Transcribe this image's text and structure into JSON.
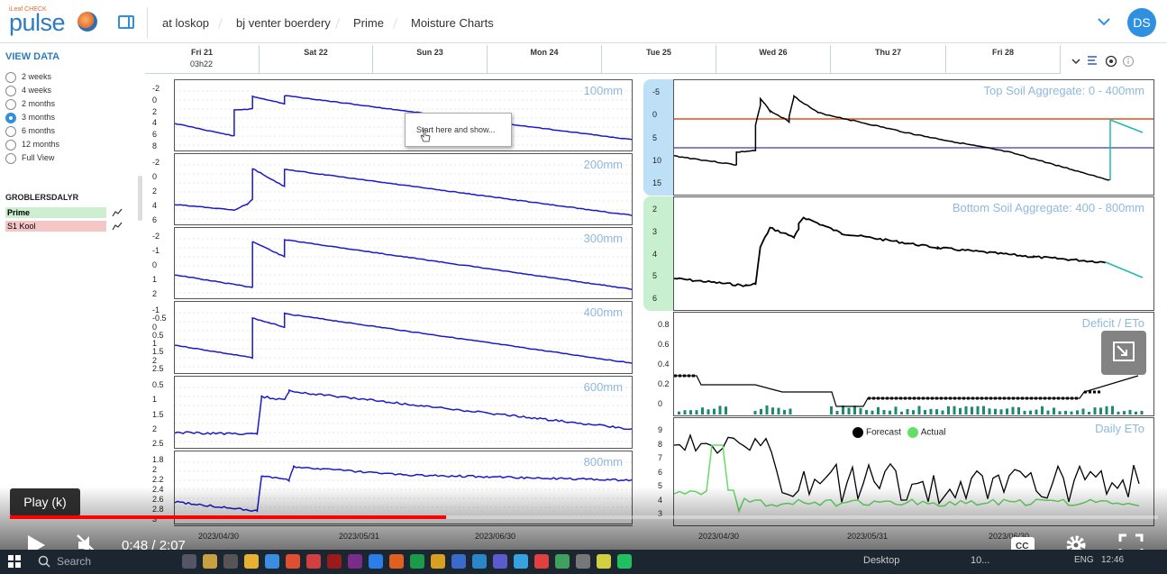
{
  "app": {
    "logo_text": "pulse",
    "logo_sub": "iLeaf CHECK",
    "avatar": "DS"
  },
  "breadcrumb": [
    "at loskop",
    "bj venter boerdery",
    "Prime",
    "Moisture Charts"
  ],
  "sidebar": {
    "title": "VIEW DATA",
    "ranges": [
      {
        "label": "2 weeks",
        "selected": false
      },
      {
        "label": "4 weeks",
        "selected": false
      },
      {
        "label": "2 months",
        "selected": false
      },
      {
        "label": "3 months",
        "selected": true
      },
      {
        "label": "6 months",
        "selected": false
      },
      {
        "label": "12 months",
        "selected": false
      },
      {
        "label": "Full View",
        "selected": false
      }
    ],
    "group": "GROBLERSDALYR",
    "sites": [
      {
        "label": "Prime",
        "color": "#cdeecf"
      },
      {
        "label": "S1 Kool",
        "color": "#f5c6c6"
      }
    ]
  },
  "days": [
    {
      "day": "Fri 21",
      "sub": "03h22"
    },
    {
      "day": "Sat 22",
      "sub": ""
    },
    {
      "day": "Sun 23",
      "sub": ""
    },
    {
      "day": "Mon 24",
      "sub": ""
    },
    {
      "day": "Tue 25",
      "sub": ""
    },
    {
      "day": "Wed 26",
      "sub": ""
    },
    {
      "day": "Thu 27",
      "sub": ""
    },
    {
      "day": "Fri 28",
      "sub": ""
    }
  ],
  "left_panels": [
    {
      "label": "100mm",
      "ticks": [
        "-2",
        "0",
        "2",
        "4",
        "6",
        "8"
      ]
    },
    {
      "label": "200mm",
      "ticks": [
        "-2",
        "0",
        "2",
        "4",
        "6"
      ]
    },
    {
      "label": "300mm",
      "ticks": [
        "-2",
        "-1",
        "0",
        "1",
        "2"
      ]
    },
    {
      "label": "400mm",
      "ticks": [
        "-1",
        "-0.5",
        "0",
        "0.5",
        "1",
        "1.5",
        "2",
        "2.5"
      ]
    },
    {
      "label": "600mm",
      "ticks": [
        "0.5",
        "1",
        "1.5",
        "2",
        "2.5"
      ]
    },
    {
      "label": "800mm",
      "ticks": [
        "1.8",
        "2",
        "2.2",
        "2.4",
        "2.6",
        "2.8",
        "3"
      ]
    }
  ],
  "left_x_labels": [
    "2023/04/30",
    "2023/05/31",
    "2023/06/30"
  ],
  "right_panels": {
    "top": {
      "label": "Top Soil Aggregate: 0 - 400mm",
      "ticks": [
        "-5",
        "0",
        "5",
        "10",
        "15"
      ]
    },
    "bottom": {
      "label": "Bottom Soil Aggregate: 400 - 800mm",
      "ticks": [
        "2",
        "3",
        "4",
        "5",
        "6"
      ]
    },
    "deficit": {
      "label": "Deficit / ETo",
      "ticks": [
        "0.8",
        "0.6",
        "0.4",
        "0.2",
        "0"
      ]
    },
    "eto": {
      "label": "Daily ETo",
      "legend_forecast": "Forecast",
      "legend_actual": "Actual",
      "ticks": [
        "9",
        "8",
        "7",
        "6",
        "5",
        "4",
        "3"
      ]
    }
  },
  "right_x_labels": [
    "2023/04/30",
    "2023/05/31",
    "2023/06/30"
  ],
  "tooltip": "Start here and show...",
  "player": {
    "play_tip": "Play (k)",
    "time": "0:48 / 2:07",
    "progress": 0.38
  },
  "taskbar": {
    "search": "Search",
    "desktop": "Desktop",
    "lang": "ENG",
    "clock": "12:46",
    "weather": "10..."
  },
  "colors": {
    "accent": "#2f90e0",
    "series": "#1a1acc",
    "threshold_hi": "#d9541e",
    "threshold_lo": "#3a3aaa",
    "forecast": "#20b8b0",
    "bar": "#1a8a70",
    "actual": "#66dd66"
  }
}
